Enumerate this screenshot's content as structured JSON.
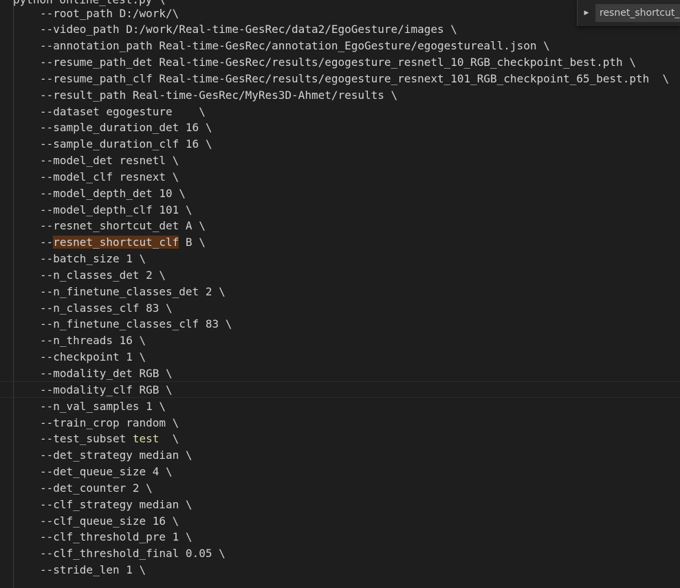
{
  "editor": {
    "first_line": "python online_test.py \\",
    "lines": [
      "--root_path D:/work/\\",
      "--video_path D:/work/Real-time-GesRec/data2/EgoGesture/images \\",
      "--annotation_path Real-time-GesRec/annotation_EgoGesture/egogestureall.json \\",
      "--resume_path_det Real-time-GesRec/results/egogesture_resnetl_10_RGB_checkpoint_best.pth \\",
      "--resume_path_clf Real-time-GesRec/results/egogesture_resnext_101_RGB_checkpoint_65_best.pth  \\",
      "--result_path Real-time-GesRec/MyRes3D-Ahmet/results \\",
      "--dataset egogesture    \\",
      "--sample_duration_det 16 \\",
      "--sample_duration_clf 16 \\",
      "--model_det resnetl \\",
      "--model_clf resnext \\",
      "--model_depth_det 10 \\",
      "--model_depth_clf 101 \\",
      "--resnet_shortcut_det A \\",
      "--resnet_shortcut_clf B \\",
      "--batch_size 1 \\",
      "--n_classes_det 2 \\",
      "--n_finetune_classes_det 2 \\",
      "--n_classes_clf 83 \\",
      "--n_finetune_classes_clf 83 \\",
      "--n_threads 16 \\",
      "--checkpoint 1 \\",
      "--modality_det RGB \\",
      "--modality_clf RGB \\",
      "--n_val_samples 1 \\",
      "--train_crop random \\",
      "--test_subset test  \\",
      "--det_strategy median \\",
      "--det_queue_size 4 \\",
      "--det_counter 2 \\",
      "--clf_strategy median \\",
      "--clf_queue_size 16 \\",
      "--clf_threshold_pre 1 \\",
      "--clf_threshold_final 0.05 \\",
      "--stride_len 1 \\"
    ],
    "highlighted_line_index": 14,
    "highlighted_text": "resnet_shortcut_clf",
    "colored_line_index": 26,
    "colored_word": "test"
  },
  "find_widget": {
    "query": "resnet_shortcut_clf",
    "toggle_icon": "chevron-right-icon"
  },
  "colors": {
    "background": "#1e1e1e",
    "text": "#d4d4d4",
    "find_match": "#5a3218",
    "keyword": "#dcdcaa"
  }
}
